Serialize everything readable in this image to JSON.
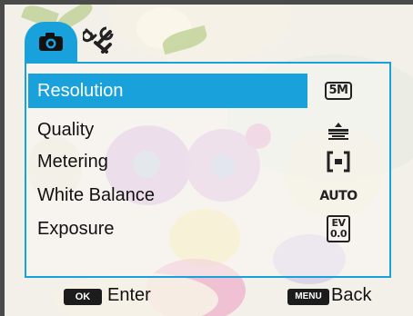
{
  "tabs": {
    "camera": {
      "icon": "camera-icon",
      "active": true
    },
    "settings": {
      "icon": "wrench-icon",
      "active": false
    }
  },
  "menu": {
    "items": [
      {
        "label": "Resolution",
        "icon": "resolution-5m-icon",
        "icon_text": "5M",
        "selected": true
      },
      {
        "label": "Quality",
        "icon": "quality-icon",
        "selected": false
      },
      {
        "label": "Metering",
        "icon": "metering-center-icon",
        "selected": false
      },
      {
        "label": "White Balance",
        "icon": "white-balance-auto-icon",
        "icon_text": "AUTO",
        "selected": false
      },
      {
        "label": "Exposure",
        "icon": "exposure-ev-icon",
        "icon_text_top": "EV",
        "icon_text_bottom": "0.0",
        "selected": false
      }
    ]
  },
  "footer": {
    "ok_key": "OK",
    "enter_label": "Enter",
    "menu_key": "MENU",
    "back_label": "Back"
  },
  "colors": {
    "accent": "#19a1dc",
    "key_bg": "#1c1c1c"
  }
}
